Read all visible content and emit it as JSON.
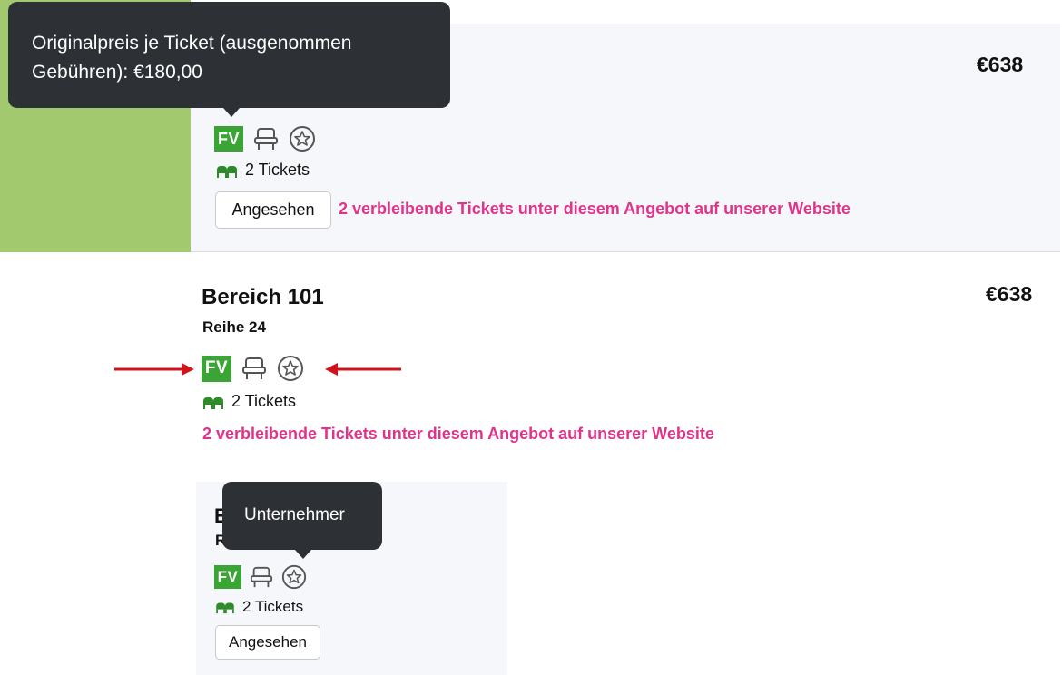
{
  "listings": [
    {
      "price": "€638",
      "badge": "FV",
      "tickets": "2 Tickets",
      "seen_button": "Angesehen",
      "remaining_text": "2 verbleibende Tickets unter diesem Angebot auf unserer Website",
      "tooltip": "Originalpreis je Ticket (ausgenommen Gebühren): €180,00"
    },
    {
      "price": "€638",
      "section": "Bereich 101",
      "row": "Reihe 24",
      "badge": "FV",
      "tickets": "2 Tickets",
      "remaining_text": "2 verbleibende Tickets unter diesem Angebot auf unserer Website"
    },
    {
      "section_partial": "E",
      "row_partial": "R",
      "badge": "FV",
      "tickets": "2 Tickets",
      "seen_button": "Angesehen",
      "tooltip": "Unternehmer"
    }
  ],
  "colors": {
    "highlight": "#a3c96f",
    "badge": "#3aa535",
    "remaining": "#e0338a",
    "tooltip_bg": "#2d3136",
    "annotation_arrow": "#d0141e"
  },
  "icons": [
    "fv-badge",
    "seat-icon",
    "star-circle-icon",
    "ticket-seats-icon",
    "arrow-right-icon",
    "arrow-left-icon"
  ]
}
